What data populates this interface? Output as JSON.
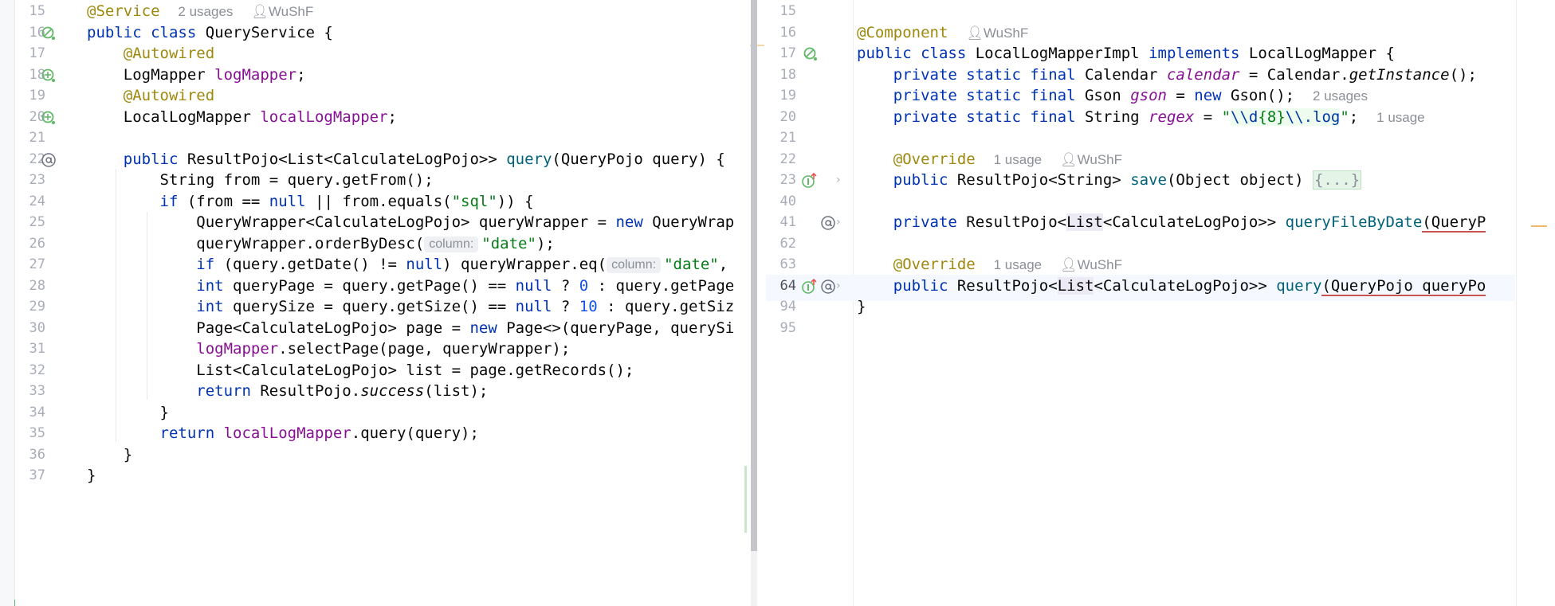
{
  "left_editor": {
    "meta": {
      "service_usages": "2 usages",
      "service_author": "WuShF"
    },
    "lines": [
      {
        "n": "15",
        "label": "line-15"
      },
      {
        "n": "16"
      },
      {
        "n": "17"
      },
      {
        "n": "18"
      },
      {
        "n": "19"
      },
      {
        "n": "20"
      },
      {
        "n": "21"
      },
      {
        "n": "22"
      },
      {
        "n": "23"
      },
      {
        "n": "24"
      },
      {
        "n": "25"
      },
      {
        "n": "26"
      },
      {
        "n": "27"
      },
      {
        "n": "28"
      },
      {
        "n": "29"
      },
      {
        "n": "30"
      },
      {
        "n": "31"
      },
      {
        "n": "32"
      },
      {
        "n": "33"
      },
      {
        "n": "34"
      },
      {
        "n": "35"
      },
      {
        "n": "36"
      },
      {
        "n": "37"
      }
    ],
    "code": {
      "l15": "@Service",
      "l16a": "public class ",
      "l16b": "QueryService {",
      "l17": "@Autowired",
      "l18a": "LogMapper ",
      "l18b": "logMapper",
      "l18c": ";",
      "l19": "@Autowired",
      "l20a": "LocalLogMapper ",
      "l20b": "localLogMapper",
      "l20c": ";",
      "l22a": "public ",
      "l22b": "ResultPojo<List<CalculateLogPojo>> ",
      "l22c": "query",
      "l22d": "(QueryPojo query) {",
      "l23": "String from = query.getFrom();",
      "l24a": "if ",
      "l24b": "(from == ",
      "l24c": "null",
      "l24d": " || from.equals(",
      "l24e": "\"sql\"",
      "l24f": ")) {",
      "l25a": "QueryWrapper<CalculateLogPojo> queryWrapper = ",
      "l25b": "new ",
      "l25c": "QueryWrap",
      "l26a": "queryWrapper.orderByDesc(",
      "l26hint": "column:",
      "l26b": "\"date\"",
      "l26c": ");",
      "l27a": "if ",
      "l27b": "(query.getDate() != ",
      "l27c": "null",
      "l27d": ") queryWrapper.eq(",
      "l27hint": "column:",
      "l27e": "\"date\"",
      "l27f": ",",
      "l28a": "int ",
      "l28b": "queryPage = query.getPage() == ",
      "l28c": "null",
      "l28d": " ? ",
      "l28e": "0",
      "l28f": " : query.getPage",
      "l29a": "int ",
      "l29b": "querySize = query.getSize() == ",
      "l29c": "null",
      "l29d": " ? ",
      "l29e": "10",
      "l29f": " : query.getSiz",
      "l30a": "Page<CalculateLogPojo> page = ",
      "l30b": "new ",
      "l30c": "Page<>(queryPage, querySi",
      "l31a": "logMapper",
      "l31b": ".selectPage(page, queryWrapper);",
      "l32": "List<CalculateLogPojo> list = page.getRecords();",
      "l33a": "return ",
      "l33b": "ResultPojo.",
      "l33c": "success",
      "l33d": "(list);",
      "l34": "}",
      "l35a": "return ",
      "l35b": "localLogMapper",
      "l35c": ".query(query);",
      "l36": "}",
      "l37": "}"
    }
  },
  "right_editor": {
    "lines": [
      {
        "n": "15"
      },
      {
        "n": "16"
      },
      {
        "n": "17"
      },
      {
        "n": "18"
      },
      {
        "n": "19"
      },
      {
        "n": "20"
      },
      {
        "n": "21"
      },
      {
        "n": "22"
      },
      {
        "n": "23"
      },
      {
        "n": "40"
      },
      {
        "n": "41"
      },
      {
        "n": "62"
      },
      {
        "n": "63"
      },
      {
        "n": "64"
      },
      {
        "n": "94"
      },
      {
        "n": "95"
      }
    ],
    "meta": {
      "component_author": "WuShF",
      "gson_usages": "2 usages",
      "regex_usages": "1 usage",
      "override1_usages": "1 usage",
      "override1_author": "WuShF",
      "override2_usages": "1 usage",
      "override2_author": "WuShF"
    },
    "code": {
      "l16": "@Component",
      "l17a": "public class ",
      "l17b": "LocalLogMapperImpl ",
      "l17c": "implements ",
      "l17d": "LocalLogMapper {",
      "l18a": "private static final ",
      "l18b": "Calendar ",
      "l18c": "calendar",
      "l18d": " = Calendar.",
      "l18e": "getInstance",
      "l18f": "();",
      "l19a": "private static final ",
      "l19b": "Gson ",
      "l19c": "gson",
      "l19d": " = ",
      "l19e": "new ",
      "l19f": "Gson();",
      "l20a": "private static final ",
      "l20b": "String ",
      "l20c": "regex",
      "l20d": " = ",
      "l20e": "\"",
      "l20f": "\\\\d",
      "l20g": "{8}",
      "l20h": "\\\\.log",
      "l20i": "\"",
      "l20j": ";",
      "l22": "@Override",
      "l23a": "public ",
      "l23b": "ResultPojo<String> ",
      "l23c": "save",
      "l23d": "(Object object) ",
      "l23e": "{...}",
      "l41a": "private ",
      "l41b": "ResultPojo<",
      "l41c": "List",
      "l41d": "<CalculateLogPojo>> ",
      "l41e": "queryFileByDate",
      "l41f": "(QueryP",
      "l63": "@Override",
      "l64a": "public ",
      "l64b": "ResultPojo<",
      "l64c": "List",
      "l64d": "<CalculateLogPojo>> ",
      "l64e": "query",
      "l64f": "(QueryPojo queryPo",
      "l94": "}"
    }
  },
  "icons": {
    "bean_icon": "spring-bean-icon",
    "implemented_icon": "implemented-icon",
    "override_icon": "override-icon",
    "at_icon": "at-icon",
    "user_icon": "user-icon",
    "chevron_icon": "chevron-right-icon"
  },
  "colors": {
    "keyword": "#0033b3",
    "annotation": "#9e880d",
    "field": "#871094",
    "method": "#00627a",
    "string": "#067d17",
    "number": "#1750eb"
  }
}
